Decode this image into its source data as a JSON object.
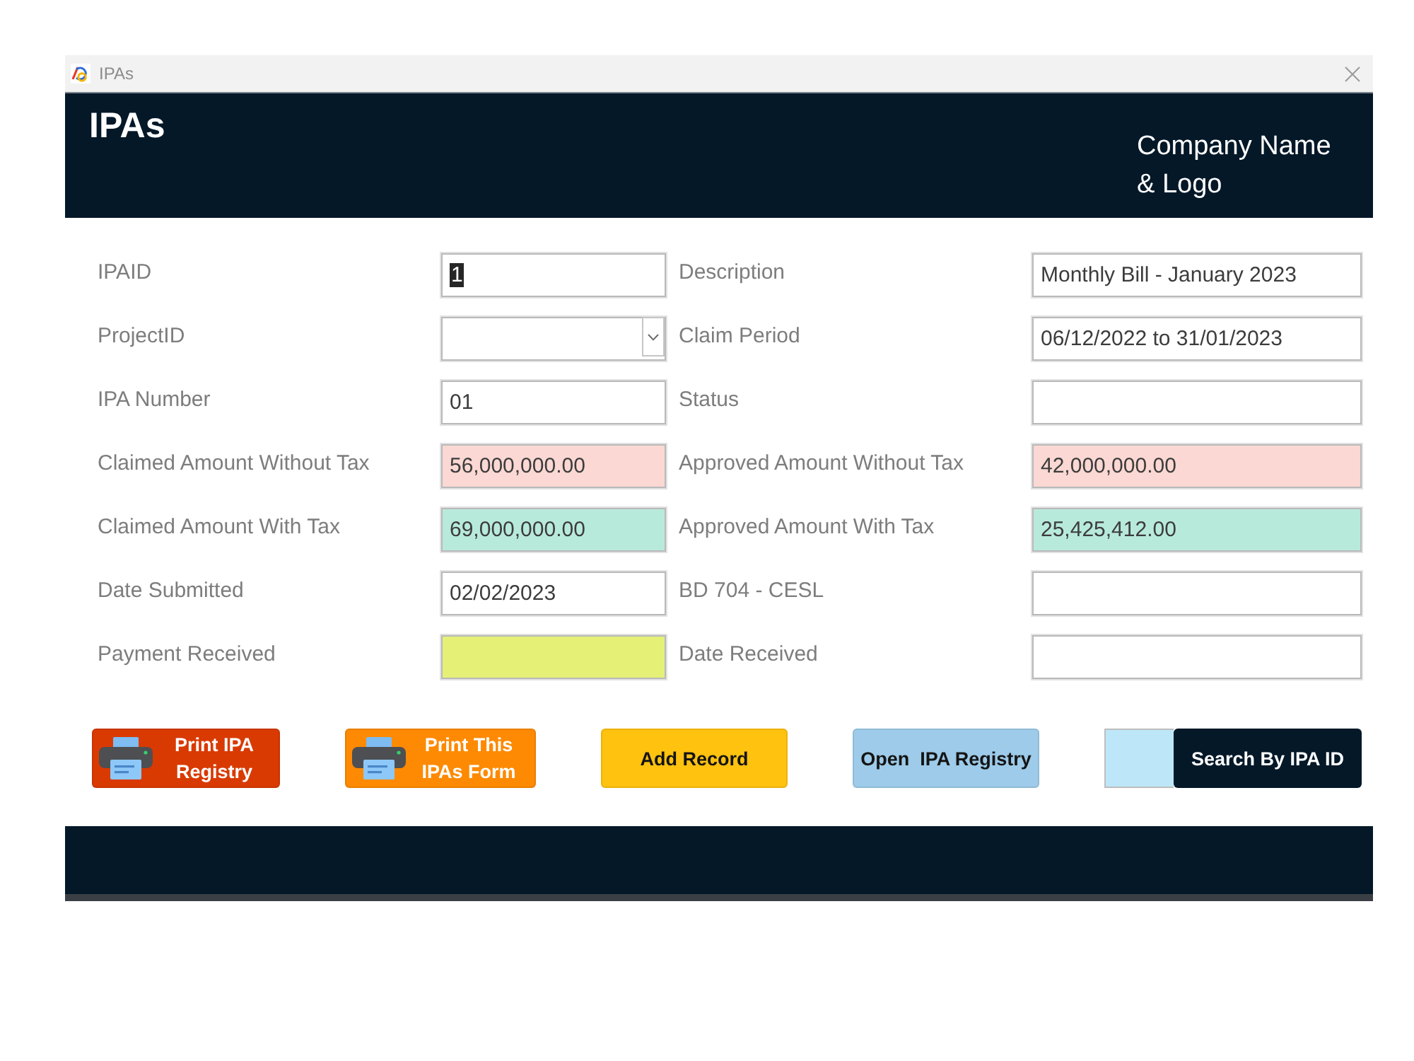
{
  "window": {
    "title": "IPAs"
  },
  "header": {
    "title": "IPAs",
    "company": "Company Name & Logo"
  },
  "form": {
    "fields": [
      {
        "label": "IPAID",
        "kind": "text",
        "value": "1",
        "text_selected": true,
        "color": "#ffffff"
      },
      {
        "label": "Description",
        "kind": "text",
        "value": "Monthly Bill - January 2023",
        "text_selected": false,
        "color": "#ffffff"
      },
      {
        "label": "ProjectID",
        "kind": "dropdown",
        "text_selected": false,
        "color": "#ffffff"
      },
      {
        "label": "Claim Period",
        "kind": "text",
        "value": "06/12/2022 to 31/01/2023",
        "text_selected": false,
        "color": "#ffffff"
      },
      {
        "label": "IPA Number",
        "kind": "text",
        "value": "01",
        "text_selected": false,
        "color": "#ffffff"
      },
      {
        "label": "Status",
        "kind": "text",
        "text_selected": false,
        "color": "#ffffff"
      },
      {
        "label": "Claimed Amount Without Tax",
        "kind": "text",
        "value": "56,000,000.00",
        "text_selected": false,
        "color": "#fbd8d3"
      },
      {
        "label": "Approved Amount Without Tax",
        "kind": "text",
        "value": "42,000,000.00",
        "text_selected": false,
        "color": "#fbd8d3"
      },
      {
        "label": "Claimed Amount With Tax",
        "kind": "text",
        "value": "69,000,000.00",
        "text_selected": false,
        "color": "#b8eadc"
      },
      {
        "label": "Approved Amount With Tax",
        "kind": "text",
        "value": "25,425,412.00",
        "text_selected": false,
        "color": "#b8eadc"
      },
      {
        "label": "Date Submitted",
        "kind": "text",
        "value": "02/02/2023",
        "text_selected": false,
        "color": "#ffffff"
      },
      {
        "label": "BD 704 - CESL",
        "kind": "text",
        "text_selected": false,
        "color": "#ffffff"
      },
      {
        "label": "Payment Received",
        "kind": "text",
        "text_selected": false,
        "color": "#e5f077"
      },
      {
        "label": "Date Received",
        "kind": "text",
        "text_selected": false,
        "color": "#ffffff"
      }
    ]
  },
  "buttons": [
    {
      "kind": "print",
      "label": "Print IPA Registry",
      "color": "#d93a02"
    },
    {
      "kind": "print",
      "label": "Print This IPAs Form",
      "color": "#fd8a02"
    },
    {
      "kind": "plain",
      "label": "Add Record",
      "color": "#ffc20f"
    },
    {
      "kind": "plain",
      "label": "Open  IPA Registry",
      "color": "#9dcbe9"
    }
  ],
  "search": {
    "button": "Search By IPA ID"
  }
}
